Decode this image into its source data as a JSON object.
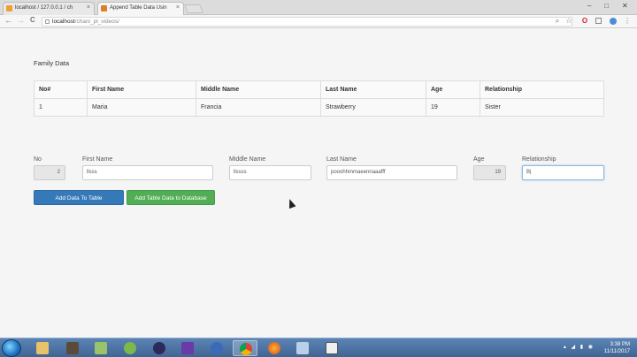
{
  "browser": {
    "tabs": [
      {
        "title": "localhost / 127.0.0.1 / ch",
        "close": "×"
      },
      {
        "title": "Append Table Data Usin",
        "close": "×"
      }
    ],
    "address": {
      "host": "localhost",
      "path": "/chani_pl_videos/"
    },
    "nav": {
      "back": "←",
      "forward": "→",
      "reload": "C"
    }
  },
  "page": {
    "section_title": "Family Data",
    "table": {
      "headers": [
        "No#",
        "First Name",
        "Middle Name",
        "Last Name",
        "Age",
        "Relationship"
      ],
      "rows": [
        [
          "1",
          "Maria",
          "Francia",
          "Strawberry",
          "19",
          "Sister"
        ]
      ]
    },
    "form": {
      "no": {
        "label": "No",
        "value": "2"
      },
      "first_name": {
        "label": "First Name",
        "value": "llsss"
      },
      "middle_name": {
        "label": "Middle Name",
        "value": "llssss"
      },
      "last_name": {
        "label": "Last Name",
        "value": "pooohhmmaeennaaafff"
      },
      "age": {
        "label": "Age",
        "value": "19"
      },
      "relationship": {
        "label": "Relationship",
        "value": "B|"
      }
    },
    "buttons": {
      "add_to_table": "Add Data To Table",
      "add_to_database": "Add Table Data to Database"
    }
  },
  "taskbar": {
    "clock_time": "3:38 PM",
    "clock_date": "11/11/2017"
  },
  "colors": {
    "primary": "#3579b8",
    "success": "#52ae55"
  }
}
